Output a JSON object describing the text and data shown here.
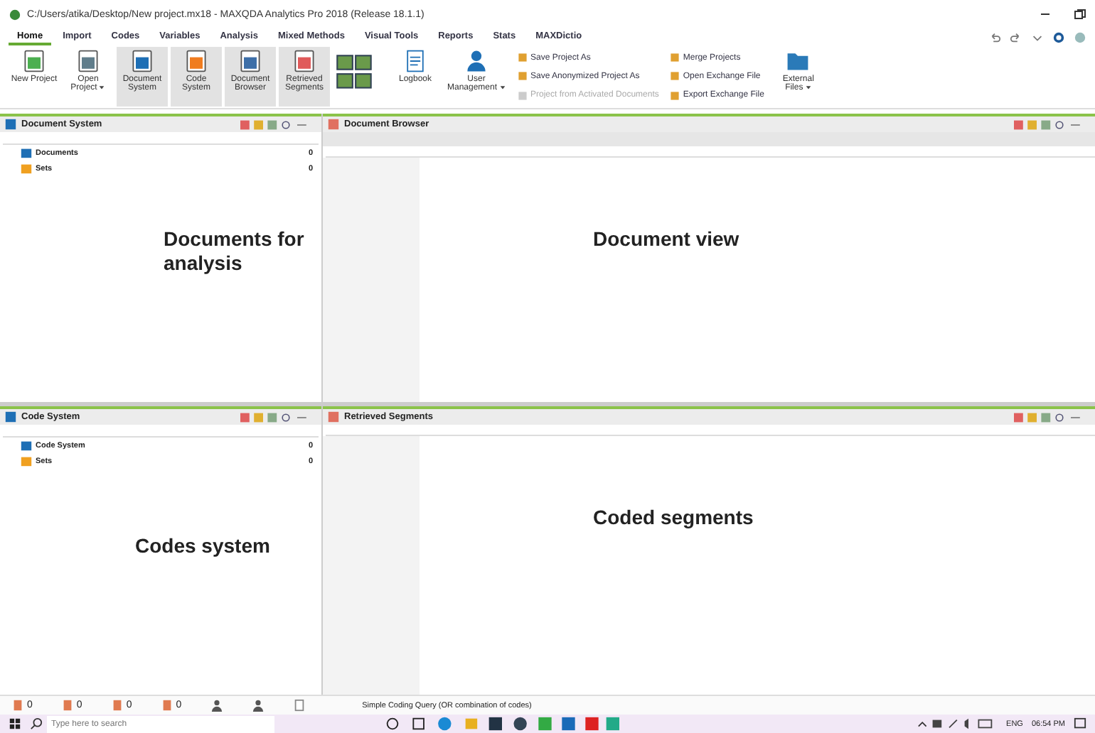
{
  "window": {
    "title": "C:/Users/atika/Desktop/New project.mx18 - MAXQDA Analytics Pro 2018  (Release 18.1.1)"
  },
  "menu_tabs": [
    {
      "label": "Home",
      "selected": true
    },
    {
      "label": "Import",
      "selected": false
    },
    {
      "label": "Codes",
      "selected": false
    },
    {
      "label": "Variables",
      "selected": false
    },
    {
      "label": "Analysis",
      "selected": false
    },
    {
      "label": "Mixed Methods",
      "selected": false
    },
    {
      "label": "Visual Tools",
      "selected": false
    },
    {
      "label": "Reports",
      "selected": false
    },
    {
      "label": "Stats",
      "selected": false
    },
    {
      "label": "MAXDictio",
      "selected": false
    }
  ],
  "ribbon": {
    "big_buttons": [
      {
        "label": "New Project",
        "color": "#4caf50",
        "active": false,
        "dropdown": false
      },
      {
        "label": "Open Project",
        "color": "#607d8b",
        "active": false,
        "dropdown": true
      },
      {
        "label": "Document System",
        "color": "#1e6fb5",
        "active": true,
        "dropdown": false
      },
      {
        "label": "Code System",
        "color": "#f07c1f",
        "active": true,
        "dropdown": false
      },
      {
        "label": "Document Browser",
        "color": "#3d6fa8",
        "active": true,
        "dropdown": false
      },
      {
        "label": "Retrieved Segments",
        "color": "#e05a5a",
        "active": true,
        "dropdown": false
      }
    ],
    "logbook": {
      "label": "Logbook"
    },
    "user_management": {
      "label": "User Management",
      "dropdown": true
    },
    "small_buttons": [
      {
        "label": "Save Project As",
        "disabled": false
      },
      {
        "label": "Save Anonymized Project As",
        "disabled": false
      },
      {
        "label": "Project from Activated Documents",
        "disabled": true
      },
      {
        "label": "Merge Projects",
        "disabled": false
      },
      {
        "label": "Open Exchange File",
        "disabled": false
      },
      {
        "label": "Export Exchange File",
        "disabled": false
      }
    ],
    "external": {
      "label": "External Files",
      "dropdown": true
    }
  },
  "panes": [
    {
      "kind": "tree",
      "title": "Document System",
      "items": [
        {
          "label": "Documents",
          "count": "0"
        },
        {
          "label": "Sets",
          "count": "0"
        }
      ],
      "annotation": "Documents for analysis"
    },
    {
      "kind": "view",
      "title": "Document Browser",
      "annotation": "Document view"
    },
    {
      "kind": "tree",
      "title": "Code System",
      "items": [
        {
          "label": "Code System",
          "count": "0"
        },
        {
          "label": "Sets",
          "count": "0"
        }
      ],
      "annotation": "Codes system"
    },
    {
      "kind": "view",
      "title": "Retrieved Segments",
      "annotation": "Coded segments"
    }
  ],
  "status_bar": {
    "counts": [
      "0",
      "0",
      "0",
      "0"
    ],
    "query": "Simple Coding Query (OR combination of codes)"
  },
  "taskbar": {
    "search": {
      "placeholder": "Type here to search"
    },
    "language": "ENG",
    "time": "06:54 PM"
  }
}
